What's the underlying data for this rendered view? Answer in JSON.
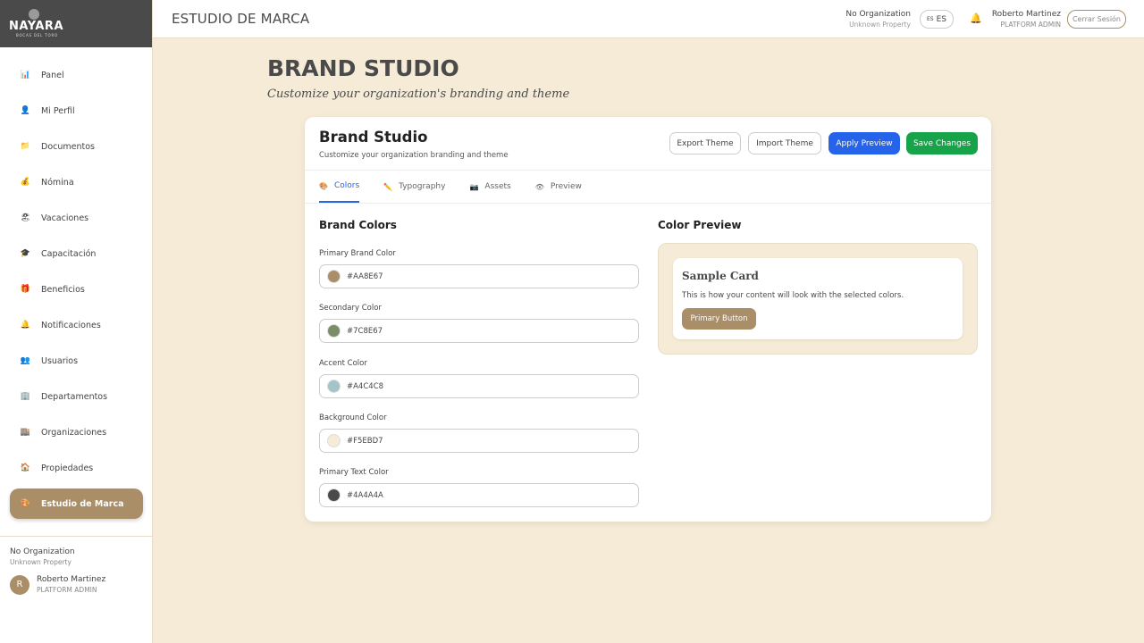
{
  "brand": {
    "name": "NAYARA",
    "tagline": "BOCAS DEL TORO"
  },
  "sidebar": {
    "items": [
      {
        "label": "Panel",
        "icon": "bar-chart-icon"
      },
      {
        "label": "Mi Perfil",
        "icon": "person-icon"
      },
      {
        "label": "Documentos",
        "icon": "folder-icon"
      },
      {
        "label": "Nómina",
        "icon": "money-bag-icon"
      },
      {
        "label": "Vacaciones",
        "icon": "beach-icon"
      },
      {
        "label": "Capacitación",
        "icon": "graduation-cap-icon"
      },
      {
        "label": "Beneficios",
        "icon": "gift-icon"
      },
      {
        "label": "Notificaciones",
        "icon": "bell-icon"
      },
      {
        "label": "Usuarios",
        "icon": "users-icon"
      },
      {
        "label": "Departamentos",
        "icon": "building-icon"
      },
      {
        "label": "Organizaciones",
        "icon": "office-icon"
      },
      {
        "label": "Propiedades",
        "icon": "house-icon"
      },
      {
        "label": "Estudio de Marca",
        "icon": "palette-icon",
        "active": true
      }
    ],
    "footer": {
      "org": "No Organization",
      "property": "Unknown Property",
      "avatar_initial": "R",
      "user_name": "Roberto Martinez",
      "user_role": "PLATFORM ADMIN"
    }
  },
  "topbar": {
    "title": "ESTUDIO DE MARCA",
    "org": "No Organization",
    "property": "Unknown Property",
    "lang_flag": "ES",
    "lang": "ES",
    "user_name": "Roberto Martinez",
    "user_role": "PLATFORM ADMIN",
    "logout_label": "Cerrar Sesión"
  },
  "page": {
    "title": "BRAND STUDIO",
    "subtitle": "Customize your organization's branding and theme"
  },
  "card": {
    "title": "Brand Studio",
    "description": "Customize your organization branding and theme",
    "buttons": {
      "export": "Export Theme",
      "import": "Import Theme",
      "apply": "Apply Preview",
      "save": "Save Changes"
    },
    "tabs": [
      {
        "label": "Colors",
        "icon": "palette-icon",
        "active": true
      },
      {
        "label": "Typography",
        "icon": "pencil-icon"
      },
      {
        "label": "Assets",
        "icon": "camera-icon"
      },
      {
        "label": "Preview",
        "icon": "eye-icon"
      }
    ],
    "brand_colors": {
      "title": "Brand Colors",
      "fields": [
        {
          "label": "Primary Brand Color",
          "value": "#AA8E67"
        },
        {
          "label": "Secondary Color",
          "value": "#7C8E67"
        },
        {
          "label": "Accent Color",
          "value": "#A4C4C8"
        },
        {
          "label": "Background Color",
          "value": "#F5EBD7"
        },
        {
          "label": "Primary Text Color",
          "value": "#4A4A4A"
        }
      ]
    },
    "color_preview": {
      "title": "Color Preview",
      "sample_title": "Sample Card",
      "sample_text": "This is how your content will look with the selected colors.",
      "button_label": "Primary Button"
    }
  },
  "colors": {
    "primary": "#AA8E67",
    "background": "#F5EBD7",
    "text": "#4A4A4A",
    "apply_button": "#2563EB",
    "save_button": "#16A34A",
    "logo_bg": "#4A4A4A"
  }
}
